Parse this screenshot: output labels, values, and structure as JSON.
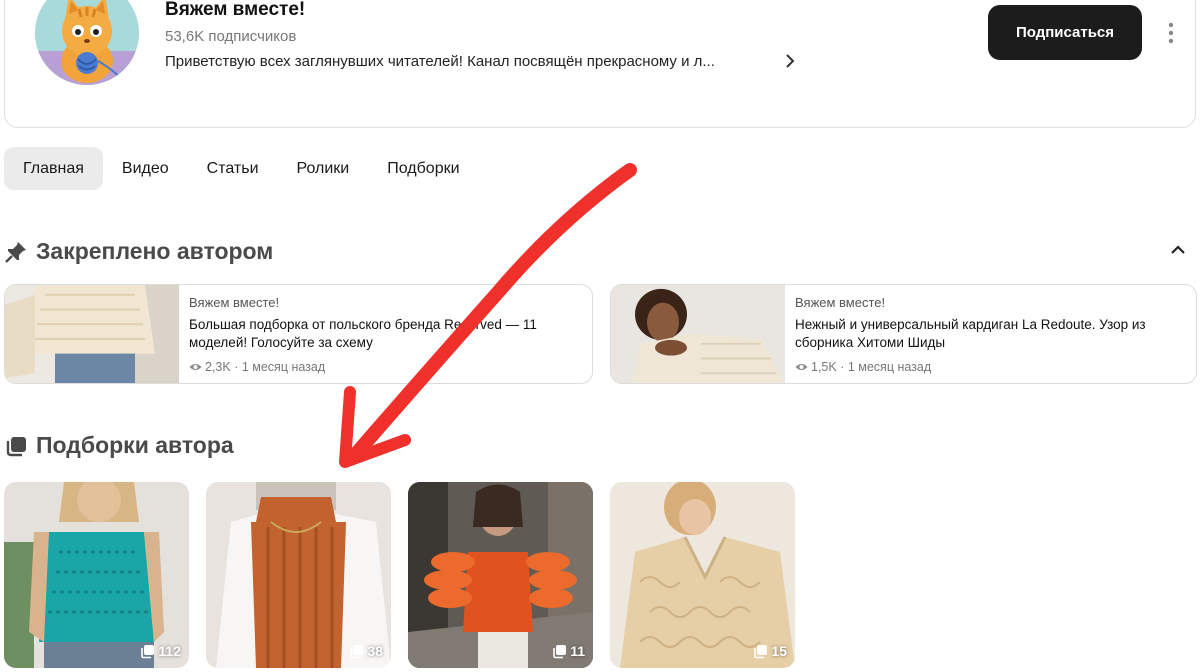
{
  "channel": {
    "name": "Вяжем вместе!",
    "subscribers": "53,6K подписчиков",
    "description": "Приветствую всех заглянувших читателей! Канал посвящён прекрасному и л...",
    "subscribe_label": "Подписаться",
    "avatar_icon": "cat-knitting-avatar"
  },
  "tabs": [
    {
      "label": "Главная",
      "active": true
    },
    {
      "label": "Видео",
      "active": false
    },
    {
      "label": "Статьи",
      "active": false
    },
    {
      "label": "Ролики",
      "active": false
    },
    {
      "label": "Подборки",
      "active": false
    }
  ],
  "pinned": {
    "title": "Закреплено автором",
    "icon": "pin-icon",
    "cards": [
      {
        "channel": "Вяжем вместе!",
        "title": "Большая подборка от польского бренда Reserved — 11 моделей! Голосуйте за схему",
        "views": "2,3K",
        "time": "1 месяц назад"
      },
      {
        "channel": "Вяжем вместе!",
        "title": "Нежный и универсальный кардиган La Redoute. Узор из сборника Хитоми Шиды",
        "views": "1,5K",
        "time": "1 месяц назад"
      }
    ]
  },
  "collections": {
    "title": "Подборки автора",
    "icon": "collection-stack-icon",
    "items": [
      {
        "count": "112"
      },
      {
        "count": "38"
      },
      {
        "count": "11"
      },
      {
        "count": "15"
      }
    ]
  },
  "colors": {
    "subscribe_bg": "#1c1c1c",
    "active_tab_bg": "#ebebeb",
    "annotation_arrow": "#f0302a"
  }
}
